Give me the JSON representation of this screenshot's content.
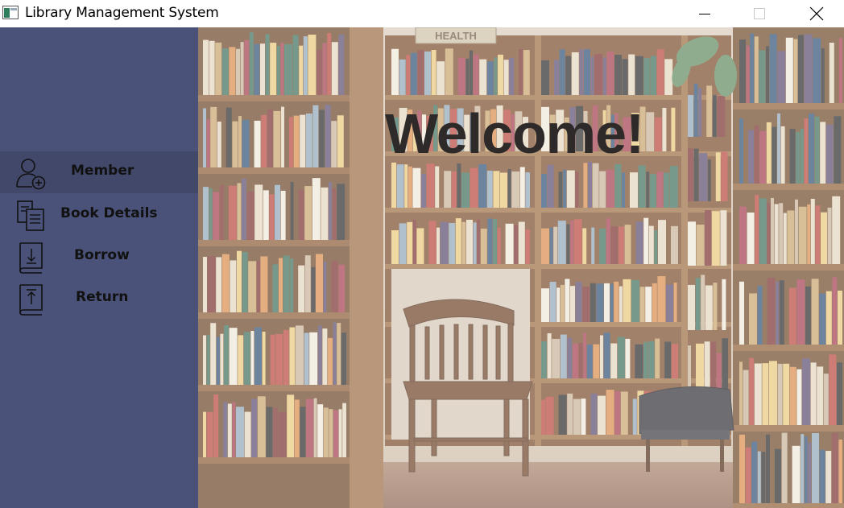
{
  "window": {
    "title": "Library Management System",
    "controls": {
      "minimize_icon": "minimize-icon",
      "maximize_icon": "maximize-icon",
      "close_icon": "close-icon"
    }
  },
  "sidebar": {
    "background_color": "#4a5279",
    "active_item_color": "#42486a",
    "items": [
      {
        "label": "Member",
        "icon": "add-member-icon",
        "active": true
      },
      {
        "label": "Book Details",
        "icon": "book-details-icon",
        "active": false
      },
      {
        "label": "Borrow",
        "icon": "borrow-book-icon",
        "active": false
      },
      {
        "label": "Return",
        "icon": "return-book-icon",
        "active": false
      }
    ]
  },
  "main": {
    "welcome_text": "Welcome!",
    "background_image": "bookstore-shelves-photo",
    "sign_text": "HEALTH"
  }
}
